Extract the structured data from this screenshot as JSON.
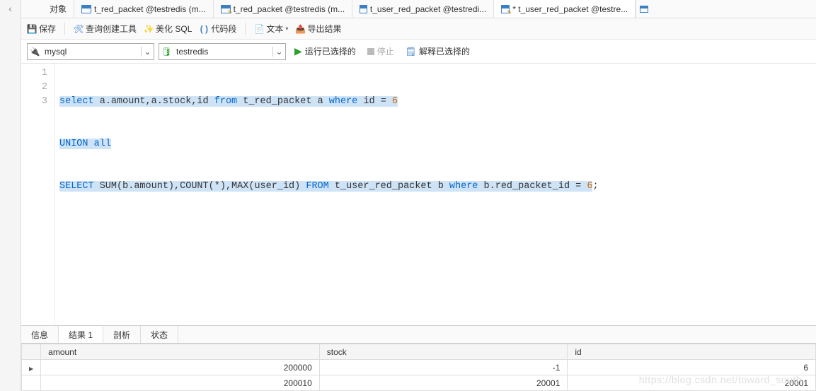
{
  "tabs": {
    "items": [
      {
        "label": "对象"
      },
      {
        "label": "t_red_packet @testredis (m..."
      },
      {
        "label": "t_red_packet @testredis (m..."
      },
      {
        "label": "t_user_red_packet @testredi..."
      },
      {
        "label": "* t_user_red_packet @testre..."
      }
    ]
  },
  "toolbar": {
    "save": "保存",
    "query_tool": "查询创建工具",
    "beautify": "美化 SQL",
    "snippet": "代码段",
    "text": "文本",
    "export": "导出结果"
  },
  "dropdowns": {
    "conn": "mysql",
    "db": "testredis",
    "run": "运行已选择的",
    "stop": "停止",
    "explain": "解释已选择的"
  },
  "editor": {
    "lines": [
      "1",
      "2",
      "3"
    ],
    "l1": {
      "select": "select",
      "mid": " a.amount,a.stock,id ",
      "from": "from",
      "tbl": " t_red_packet a ",
      "where": "where",
      "cond": " id = ",
      "val": "6"
    },
    "l2": {
      "union": "UNION",
      "all": " all"
    },
    "l3": {
      "select": "SELECT",
      "agg": " SUM(b.amount),COUNT(*),MAX(user_id) ",
      "from": "FROM",
      "tbl": " t_user_red_packet b ",
      "where": "where",
      "cond": " b.red_packet_id = ",
      "val": "6",
      "semi": ";"
    }
  },
  "bottom_tabs": {
    "info": "信息",
    "result": "结果 1",
    "analyze": "剖析",
    "status": "状态"
  },
  "result_grid": {
    "headers": [
      "amount",
      "stock",
      "id"
    ],
    "rows": [
      [
        "200000",
        "-1",
        "6"
      ],
      [
        "200010",
        "20001",
        "20001"
      ]
    ]
  },
  "watermark": "https://blog.csdn.net/toward_south"
}
